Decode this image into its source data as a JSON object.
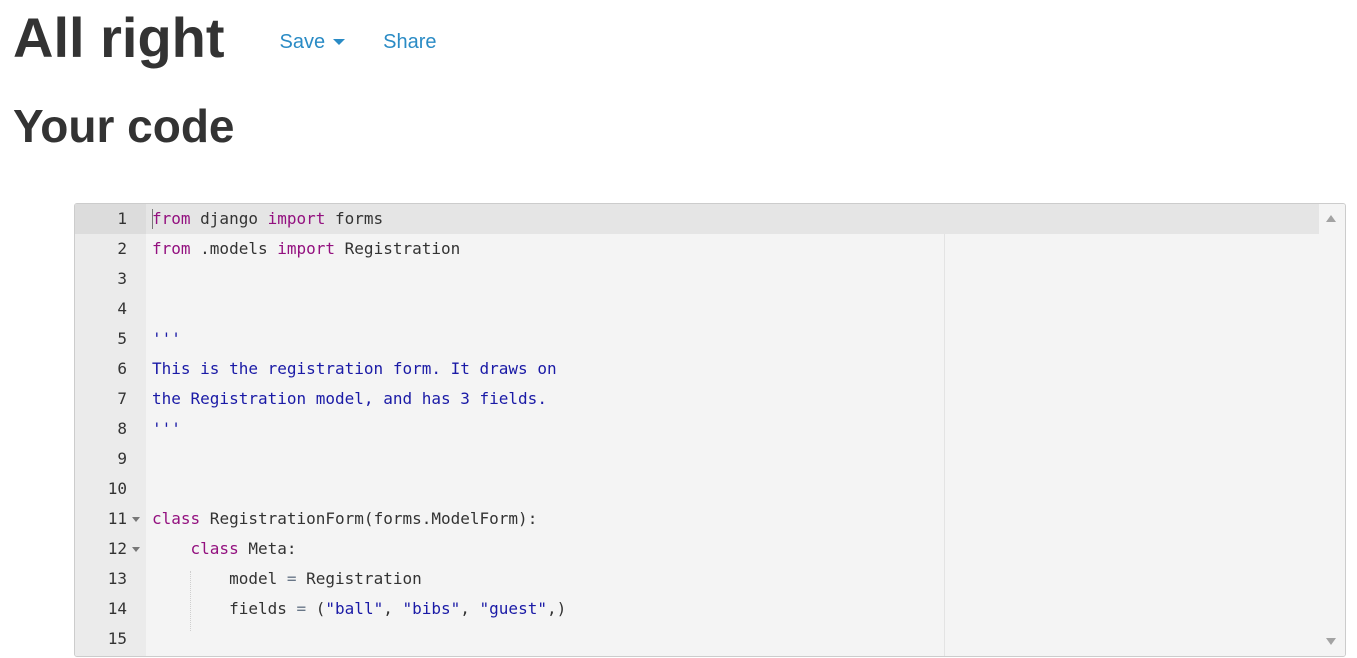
{
  "header": {
    "title": "All right",
    "save_label": "Save",
    "share_label": "Share"
  },
  "subtitle": "Your code",
  "editor": {
    "lines": [
      {
        "n": "1",
        "tokens": [
          {
            "t": "from",
            "c": "kw"
          },
          {
            "t": " django "
          },
          {
            "t": "import",
            "c": "kw"
          },
          {
            "t": " forms"
          }
        ]
      },
      {
        "n": "2",
        "tokens": [
          {
            "t": "from",
            "c": "kw"
          },
          {
            "t": " .models "
          },
          {
            "t": "import",
            "c": "kw"
          },
          {
            "t": " Registration"
          }
        ]
      },
      {
        "n": "3",
        "tokens": []
      },
      {
        "n": "4",
        "tokens": []
      },
      {
        "n": "5",
        "tokens": [
          {
            "t": "'''",
            "c": "str"
          }
        ]
      },
      {
        "n": "6",
        "tokens": [
          {
            "t": "This is the registration form. It draws on",
            "c": "str"
          }
        ]
      },
      {
        "n": "7",
        "tokens": [
          {
            "t": "the Registration model, and has 3 fields.",
            "c": "str"
          }
        ]
      },
      {
        "n": "8",
        "tokens": [
          {
            "t": "'''",
            "c": "str"
          }
        ]
      },
      {
        "n": "9",
        "tokens": []
      },
      {
        "n": "10",
        "tokens": []
      },
      {
        "n": "11",
        "fold": true,
        "tokens": [
          {
            "t": "class",
            "c": "kw"
          },
          {
            "t": " RegistrationForm(forms.ModelForm):"
          }
        ]
      },
      {
        "n": "12",
        "fold": true,
        "tokens": [
          {
            "t": "    "
          },
          {
            "t": "class",
            "c": "kw"
          },
          {
            "t": " Meta:"
          }
        ]
      },
      {
        "n": "13",
        "tokens": [
          {
            "t": "        model "
          },
          {
            "t": "=",
            "c": "op"
          },
          {
            "t": " Registration"
          }
        ]
      },
      {
        "n": "14",
        "tokens": [
          {
            "t": "        fields "
          },
          {
            "t": "=",
            "c": "op"
          },
          {
            "t": " ("
          },
          {
            "t": "\"ball\"",
            "c": "str"
          },
          {
            "t": ", "
          },
          {
            "t": "\"bibs\"",
            "c": "str"
          },
          {
            "t": ", "
          },
          {
            "t": "\"guest\"",
            "c": "str"
          },
          {
            "t": ",)"
          }
        ]
      },
      {
        "n": "15",
        "tokens": []
      }
    ],
    "active_line": "1"
  },
  "icons": {
    "save_dropdown": "caret-down-icon",
    "scroll_up": "scroll-up-arrow-icon",
    "scroll_down": "scroll-down-arrow-icon",
    "fold": "fold-arrow-icon"
  },
  "colors": {
    "link": "#2a8bc5",
    "keyword": "#93107f",
    "string": "#1a1aa6",
    "editor_bg": "#f4f4f4",
    "gutter_bg": "#ebebeb",
    "active_line_bg": "#e5e5e5"
  }
}
